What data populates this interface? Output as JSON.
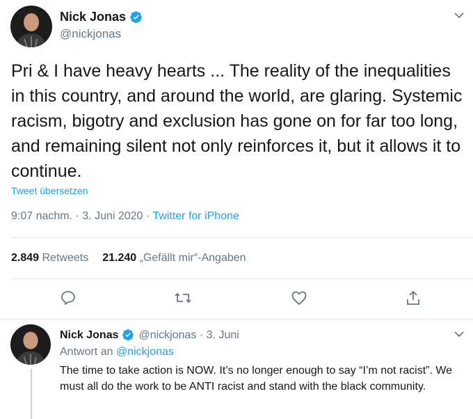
{
  "tweet": {
    "author_name": "Nick Jonas",
    "handle": "@nickjonas",
    "text": "Pri & I have heavy hearts ... The reality of the inequalities in this country, and around the world, are glaring. Systemic racism, bigotry and exclusion has gone on for far too long, and remaining silent not only reinforces it, but it allows it to continue.",
    "translate_label": "Tweet übersetzen",
    "time": "9:07 nachm. · 3. Juni 2020 · ",
    "source": "Twitter for iPhone",
    "retweets_count": "2.849",
    "retweets_label": "Retweets",
    "likes_count": "21.240",
    "likes_label": "„Gefällt mir“-Angaben"
  },
  "actions": [
    "reply-icon",
    "retweet-icon",
    "like-icon",
    "share-icon"
  ],
  "reply": {
    "author_name": "Nick Jonas",
    "handle_date": "@nickjonas · 3. Juni",
    "reply_to_label": "Antwort an ",
    "reply_to_mention": "@nickjonas",
    "text": "The time to take action is NOW. It’s no longer enough to say “I’m not racist”. We must all do the work to be ANTI racist and stand with the black community."
  },
  "colors": {
    "accent": "#1da1f2",
    "muted": "#657786",
    "text": "#14171a"
  }
}
